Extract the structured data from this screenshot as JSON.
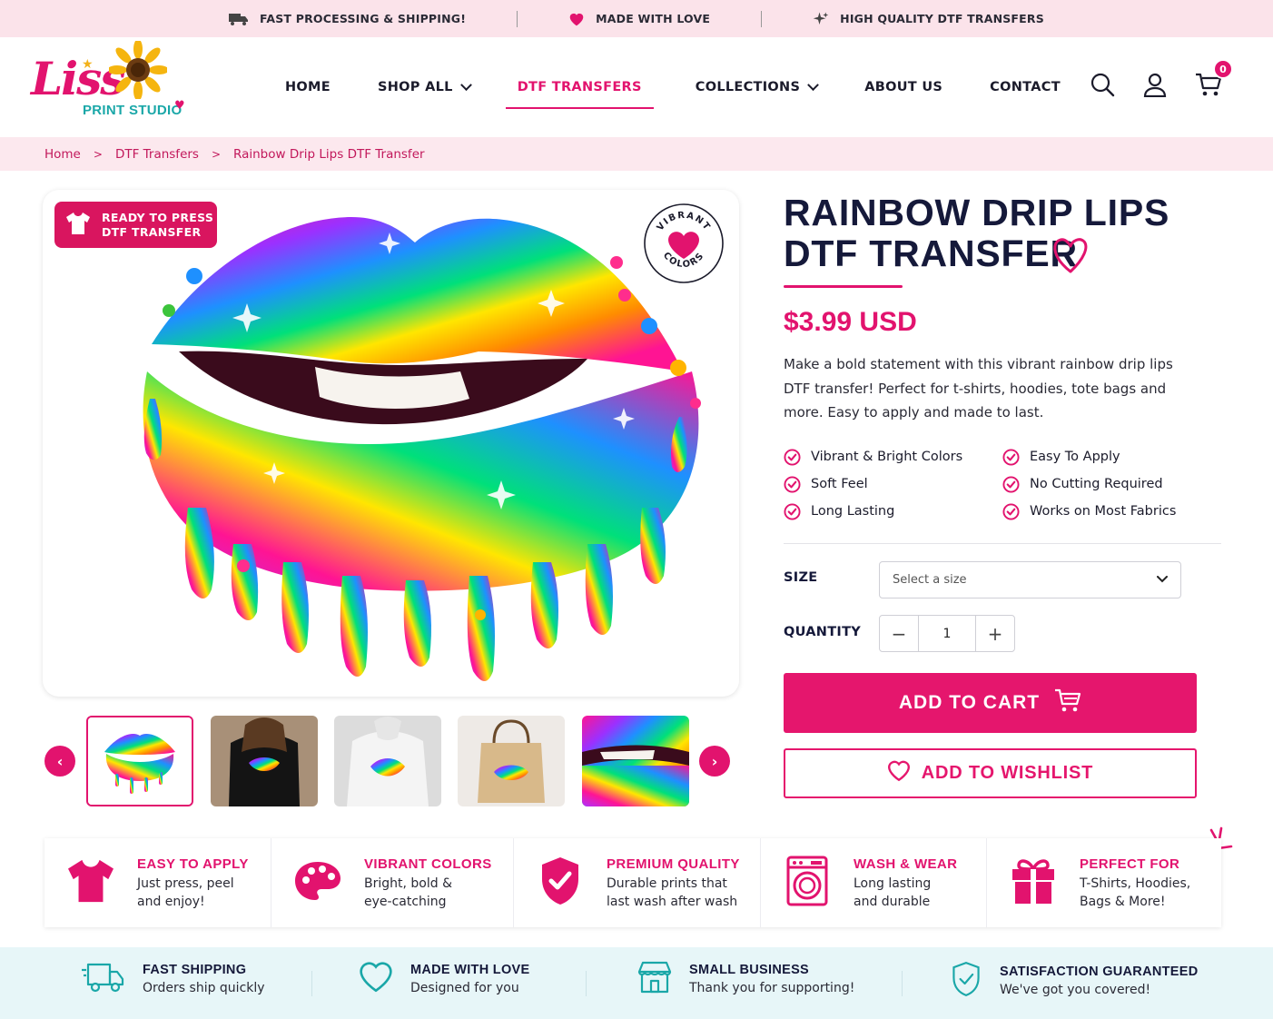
{
  "topbar": {
    "promos": [
      {
        "icon": "truck-icon",
        "label": "FAST PROCESSING & SHIPPING!"
      },
      {
        "icon": "heart-icon",
        "label": "MADE WITH LOVE"
      },
      {
        "icon": "sparkle-icon",
        "label": "HIGH QUALITY DTF TRANSFERS"
      }
    ]
  },
  "logo": {
    "name": "Liss",
    "subtitle": "PRINT STUDIO"
  },
  "nav": {
    "items": [
      {
        "label": "HOME",
        "dropdown": false,
        "active": false
      },
      {
        "label": "SHOP ALL",
        "dropdown": true,
        "active": false
      },
      {
        "label": "DTF TRANSFERS",
        "dropdown": false,
        "active": true
      },
      {
        "label": "COLLECTIONS",
        "dropdown": true,
        "active": false
      },
      {
        "label": "ABOUT US",
        "dropdown": false,
        "active": false
      },
      {
        "label": "CONTACT",
        "dropdown": false,
        "active": false
      }
    ],
    "cart_count": "0"
  },
  "breadcrumb": [
    "Home",
    "DTF Transfers",
    "Rainbow Drip Lips DTF Transfer"
  ],
  "product": {
    "badge": {
      "line1": "READY TO PRESS",
      "line2": "DTF TRANSFER"
    },
    "stamp": {
      "top": "VIBRANT",
      "bottom": "COLORS"
    },
    "title_line1": "RAINBOW DRIP LIPS",
    "title_line2": "DTF TRANSFER",
    "price": "$3.99 USD",
    "description": "Make a bold statement with this vibrant rainbow drip lips DTF transfer! Perfect for t-shirts, hoodies, tote bags and more. Easy to apply and made to last.",
    "features": [
      "Vibrant & Bright Colors",
      "Easy To Apply",
      "Soft Feel",
      "No Cutting Required",
      "Long Lasting",
      "Works on Most Fabrics"
    ],
    "size_label": "SIZE",
    "size_placeholder": "Select a size",
    "quantity_label": "QUANTITY",
    "quantity": "1",
    "add_to_cart": "ADD TO CART",
    "add_to_wishlist": "ADD TO WISHLIST"
  },
  "thumbnails": [
    "lips-design",
    "black-tshirt",
    "white-hoodie",
    "tote-bag",
    "lips-closeup"
  ],
  "cards": [
    {
      "icon": "tshirt-icon",
      "title": "EASY TO APPLY",
      "line1": "Just press, peel",
      "line2": "and enjoy!"
    },
    {
      "icon": "palette-icon",
      "title": "VIBRANT COLORS",
      "line1": "Bright, bold &",
      "line2": "eye-catching"
    },
    {
      "icon": "shield-check-icon",
      "title": "PREMIUM QUALITY",
      "line1": "Durable prints that",
      "line2": "last wash after wash"
    },
    {
      "icon": "washing-machine-icon",
      "title": "WASH & WEAR",
      "line1": "Long lasting",
      "line2": "and durable"
    },
    {
      "icon": "gift-icon",
      "title": "PERFECT FOR",
      "line1": "T-Shirts, Hoodies,",
      "line2": "Bags & More!"
    }
  ],
  "strip": [
    {
      "icon": "truck-icon",
      "title": "FAST SHIPPING",
      "sub": "Orders ship quickly"
    },
    {
      "icon": "heart-icon",
      "title": "MADE WITH LOVE",
      "sub": "Designed for you"
    },
    {
      "icon": "store-icon",
      "title": "SMALL BUSINESS",
      "sub": "Thank you for supporting!"
    },
    {
      "icon": "shield-check-icon",
      "title": "SATISFACTION GUARANTEED",
      "sub": "We've got you covered!"
    }
  ],
  "colors": {
    "brand_pink": "#e2136e",
    "teal": "#1aa7a8",
    "navy": "#15193a",
    "topbar_bg": "#fbe3ea",
    "strip_bg": "#e7f6f8"
  }
}
